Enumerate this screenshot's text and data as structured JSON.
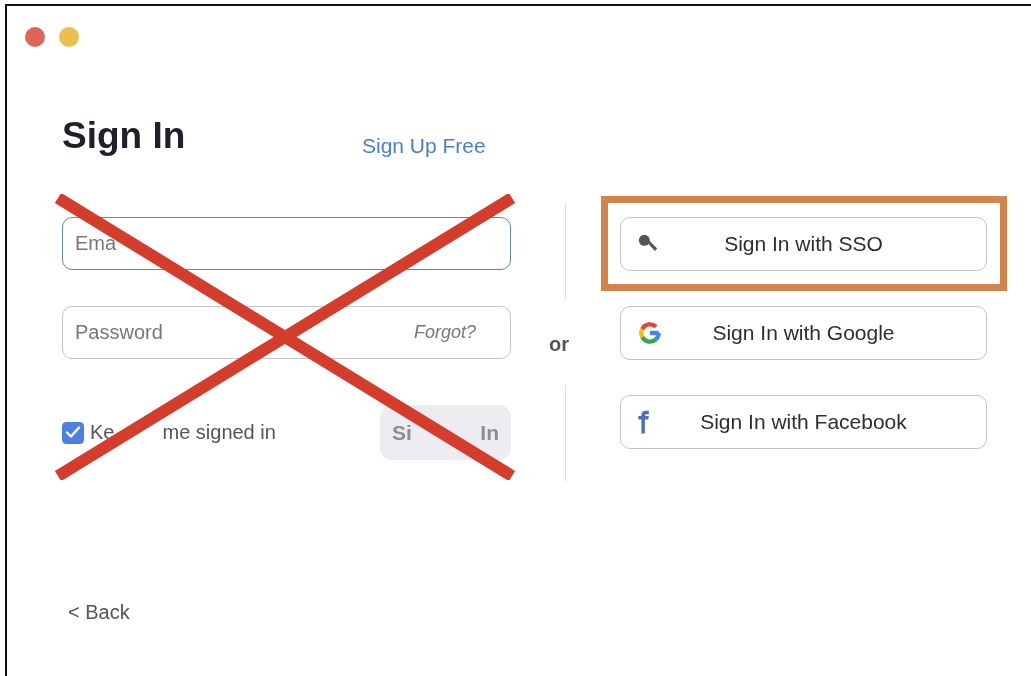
{
  "window": {
    "controls": [
      {
        "color": "#e0645a"
      },
      {
        "color": "#ebbd4e"
      }
    ]
  },
  "heading": "Sign In",
  "sign_up_link": "Sign Up Free",
  "email_field": {
    "placeholder": "Ema",
    "focused": true
  },
  "password_field": {
    "placeholder": "Password",
    "forgot_link": "Forgot?"
  },
  "keep_signed_in": {
    "label_parts": [
      "Ke",
      "me signed in"
    ],
    "checked": true
  },
  "sign_in_button": {
    "label_parts": [
      "Si",
      "In"
    ],
    "disabled": true
  },
  "separator": "or",
  "providers": [
    {
      "kind": "sso",
      "label": "Sign In with SSO",
      "highlighted": true
    },
    {
      "kind": "google",
      "label": "Sign In with Google",
      "highlighted": false
    },
    {
      "kind": "facebook",
      "label": "Sign In with Facebook",
      "highlighted": false
    }
  ],
  "back_link": "< Back",
  "annotations": {
    "cross_out_form": true
  }
}
